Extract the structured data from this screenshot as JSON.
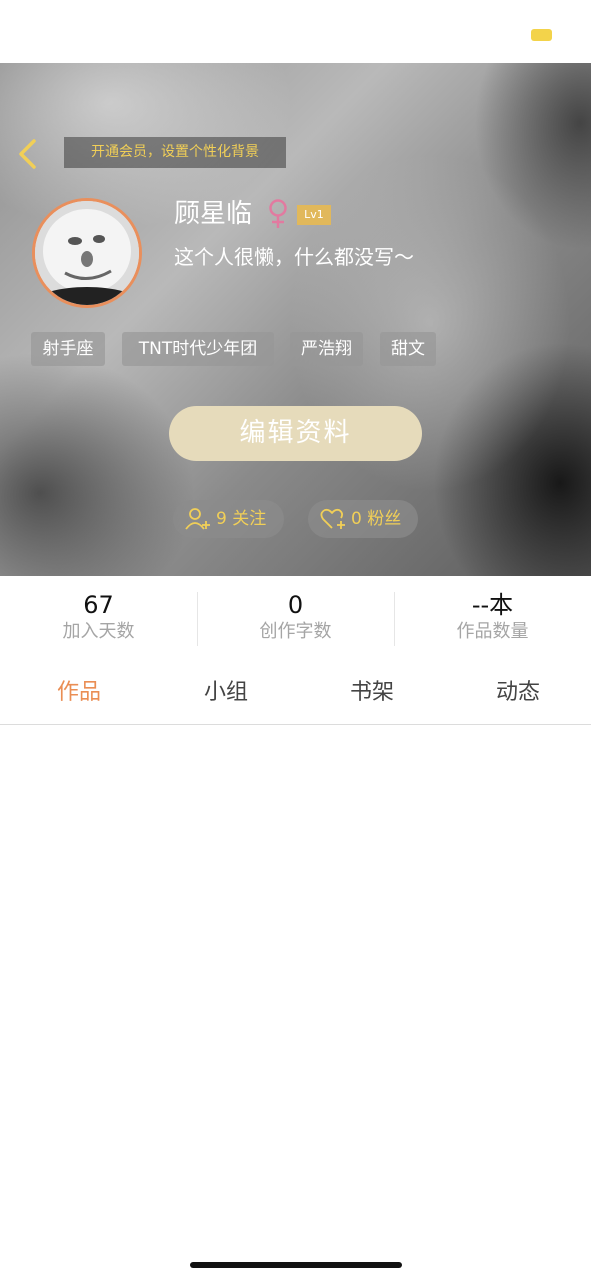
{
  "header": {
    "vip_banner": "开通会员，设置个性化背景"
  },
  "profile": {
    "name": "顾星临",
    "gender_icon": "female-icon",
    "level": "Lv1",
    "bio": "这个人很懒，什么都没写～",
    "tags": [
      "射手座",
      "TNT时代少年团",
      "严浩翔",
      "甜文"
    ],
    "edit_button": "编辑资料",
    "following": "9 关注",
    "followers": "0 粉丝"
  },
  "stats": [
    {
      "value": "67",
      "label": "加入天数"
    },
    {
      "value": "0",
      "label": "创作字数"
    },
    {
      "value": "--本",
      "label": "作品数量"
    }
  ],
  "tabs": [
    {
      "label": "作品",
      "active": true
    },
    {
      "label": "小组",
      "active": false
    },
    {
      "label": "书架",
      "active": false
    },
    {
      "label": "动态",
      "active": false
    }
  ],
  "colors": {
    "accent": "#ea8e54",
    "gold": "#f1cf57",
    "edit_button_bg": "#e6dbbb",
    "level_badge": "#e1b85b"
  }
}
